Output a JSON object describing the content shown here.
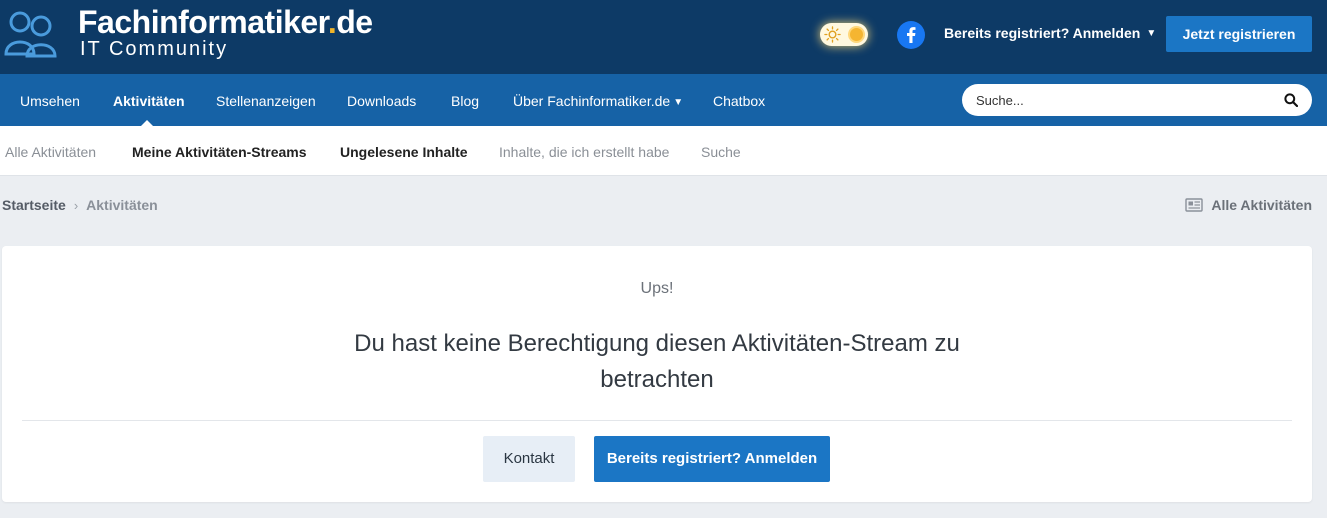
{
  "header": {
    "logo_title_main": "Fachinformatiker",
    "logo_title_dot": ".",
    "logo_title_tld": "de",
    "logo_subtitle": "IT Community",
    "signin_label": "Bereits registriert? Anmelden",
    "register_label": "Jetzt registrieren"
  },
  "mainnav": {
    "items": [
      {
        "label": "Umsehen"
      },
      {
        "label": "Aktivitäten"
      },
      {
        "label": "Stellenanzeigen"
      },
      {
        "label": "Downloads"
      },
      {
        "label": "Blog"
      },
      {
        "label": "Über Fachinformatiker.de"
      },
      {
        "label": "Chatbox"
      }
    ],
    "active_label": "Aktivitäten",
    "search_placeholder": "Suche..."
  },
  "subnav": {
    "items": [
      {
        "label": "Alle Aktivitäten"
      },
      {
        "label": "Meine Aktivitäten-Streams"
      },
      {
        "label": "Ungelesene Inhalte"
      },
      {
        "label": "Inhalte, die ich erstellt habe"
      },
      {
        "label": "Suche"
      }
    ]
  },
  "breadcrumb": {
    "home": "Startseite",
    "current": "Aktivitäten",
    "right_link": "Alle Aktivitäten"
  },
  "content": {
    "heading": "Ups!",
    "message": "Du hast keine Berechtigung diesen Aktivitäten-Stream zu betrachten",
    "contact_button": "Kontakt",
    "login_button": "Bereits registriert? Anmelden"
  },
  "colors": {
    "header_bg": "#0d3a66",
    "nav_bg": "#1662a6",
    "accent": "#1b76c5",
    "logo_dot": "#f0b429",
    "page_bg": "#ebeef2"
  },
  "icons": {
    "logo": "users-icon",
    "theme": "sun-icon",
    "social": "facebook-icon",
    "search": "search-icon",
    "all_activity": "newspaper-icon",
    "breadcrumb_separator": "chevron-right-icon"
  }
}
